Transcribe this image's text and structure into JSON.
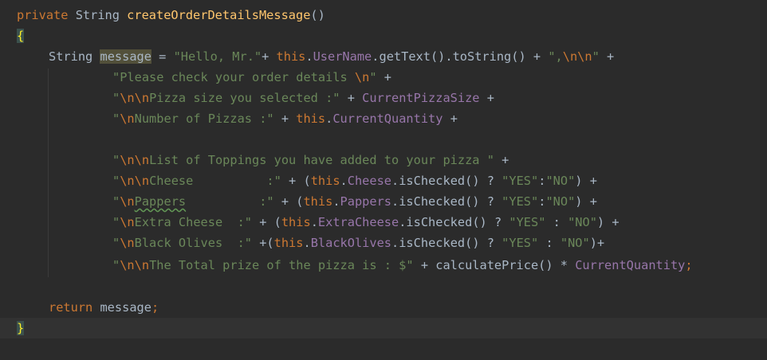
{
  "code": {
    "l1": {
      "kw_private": "private",
      "t_string": "String",
      "fn_name": "createOrderDetailsMessage",
      "p": "()"
    },
    "l2": {
      "brace": "{"
    },
    "l3": {
      "t_string": "String",
      "var": "message",
      "eq": " = ",
      "s1": "\"Hello, Mr.\"",
      "plus1": "+ ",
      "kw_this": "this",
      "dot1": ".",
      "fld": "UserName",
      "call": ".getText().toString() + ",
      "s2a": "\",",
      "e2": "\\n\\n",
      "s2b": "\"",
      "tail": " +"
    },
    "l4": {
      "s_a": "\"Please check your order details ",
      "e": "\\n",
      "s_b": "\"",
      "tail": " +"
    },
    "l5": {
      "s_a": "\"",
      "e": "\\n\\n",
      "s_b": "Pizza size you selected :\"",
      "mid": " + ",
      "fld": "CurrentPizzaSize",
      "tail": " +"
    },
    "l6": {
      "s_a": "\"",
      "e": "\\n",
      "s_b": "Number of Pizzas :\"",
      "mid": " + ",
      "kw_this": "this",
      "dot": ".",
      "fld": "CurrentQuantity",
      "tail": " +"
    },
    "l8": {
      "s_a": "\"",
      "e": "\\n\\n",
      "s_b": "List of Toppings you have added to your pizza \"",
      "tail": " +"
    },
    "l9": {
      "s_a": "\"",
      "e": "\\n\\n",
      "s_b": "Cheese          :\"",
      "mid": " + (",
      "kw_this": "this",
      "dot": ".",
      "fld": "Cheese",
      "call": ".isChecked() ? ",
      "s_yes": "\"YES\"",
      "colon": ":",
      "s_no": "\"NO\"",
      "tail": ") +"
    },
    "l10": {
      "s_a": "\"",
      "e": "\\n",
      "s_word": "Pappers",
      "s_b": "          :\"",
      "mid": " + (",
      "kw_this": "this",
      "dot": ".",
      "fld": "Pappers",
      "call": ".isChecked() ? ",
      "s_yes": "\"YES\"",
      "colon": ":",
      "s_no": "\"NO\"",
      "tail": ") +"
    },
    "l11": {
      "s_a": "\"",
      "e": "\\n",
      "s_b": "Extra Cheese  :\"",
      "mid": " + (",
      "kw_this": "this",
      "dot": ".",
      "fld": "ExtraCheese",
      "call": ".isChecked() ? ",
      "s_yes": "\"YES\"",
      "colon": " : ",
      "s_no": "\"NO\"",
      "tail": ") +"
    },
    "l12": {
      "s_a": "\"",
      "e": "\\n",
      "s_b": "Black Olives  :\"",
      "mid": " +(",
      "kw_this": "this",
      "dot": ".",
      "fld": "BlackOlives",
      "call": ".isChecked() ? ",
      "s_yes": "\"YES\"",
      "colon": " : ",
      "s_no": "\"NO\"",
      "tail": ")+"
    },
    "l13": {
      "s_a": "\"",
      "e": "\\n\\n",
      "s_b": "The Total prize of the pizza is : $\"",
      "mid": " + calculatePrice() * ",
      "fld": "CurrentQuantity",
      "semi": ";"
    },
    "l15": {
      "kw_return": "return",
      "var": " message",
      "semi": ";"
    },
    "l16": {
      "brace": "}"
    }
  },
  "colors": {
    "background": "#2b2b2b",
    "keyword": "#cc7832",
    "method": "#ffc66d",
    "string": "#6a8759",
    "field": "#9876aa",
    "text": "#a9b7c6"
  }
}
